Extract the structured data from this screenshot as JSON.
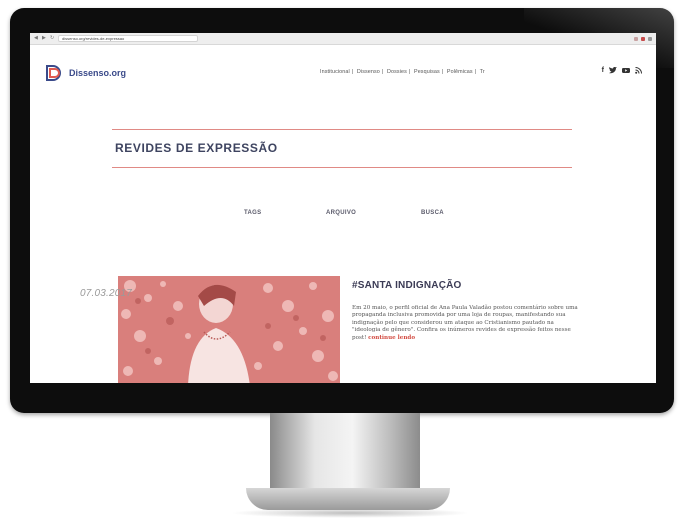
{
  "browser": {
    "url": "dissenso.org/revides-de-expressao"
  },
  "site": {
    "logo_text": "Dissenso.org",
    "nav": [
      "Institucional",
      "Dissenso",
      "Dossies",
      "Pesquisas",
      "Polêmicas",
      "Tr"
    ],
    "social_icons": [
      "facebook-icon",
      "twitter-icon",
      "youtube-icon",
      "rss-icon"
    ],
    "accent_color": "#e08a85",
    "brand_color": "#3a4a8a"
  },
  "page": {
    "title": "REVIDES DE EXPRESSÃO",
    "tabs": [
      "TAGS",
      "ARQUIVO",
      "BUSCA"
    ]
  },
  "article": {
    "date": "07.03.2017",
    "title": "#SANTA INDIGNAÇÃO",
    "body": "Em 20 maio, o perfil oficial de Ana Paula Valadão postou comentário sobre uma propaganda inclusiva promovida por uma loja de roupas, manifestando sua indignação pelo que considerou um ataque ao Cristianismo pautado na \"ideologia de gênero\". Confira os inúmeros revides de expressão feitos nesse post!",
    "link": "continue lendo"
  }
}
